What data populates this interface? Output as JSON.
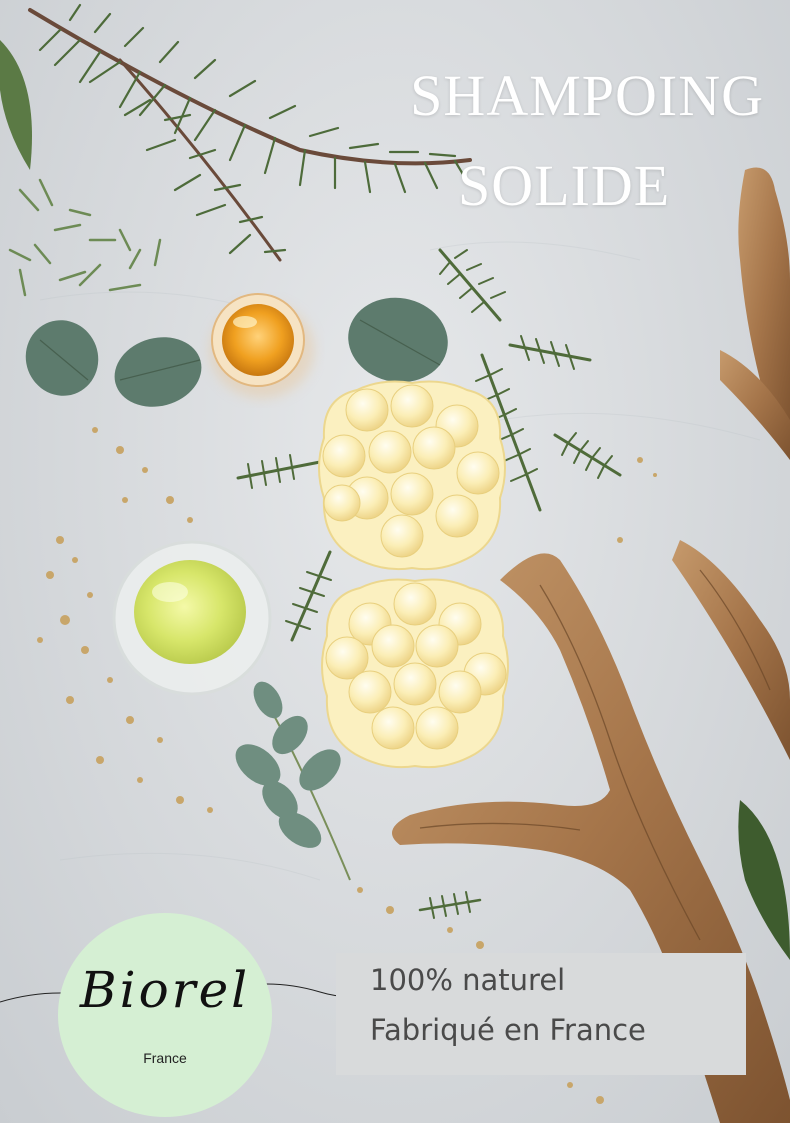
{
  "title": {
    "line1": "SHAMPOING",
    "line2": "SOLIDE"
  },
  "logo": {
    "brand": "Biorel",
    "subtitle": "France",
    "circle_color": "#d5efd3"
  },
  "badge": {
    "line1": "100%  naturel",
    "line2": "Fabriqué en France",
    "background": "#d8dadb"
  },
  "colors": {
    "background": "#d6d9dc",
    "title": "#ffffff",
    "wood": "#a5754a",
    "soap": "#fbe9a8"
  },
  "photo_items": [
    "cedar-branch",
    "rosemary-sprigs",
    "eucalyptus-leaves",
    "honey-jar",
    "oil-dish",
    "dried-chamomile",
    "driftwood",
    "shampoo-bar",
    "shampoo-bar"
  ]
}
